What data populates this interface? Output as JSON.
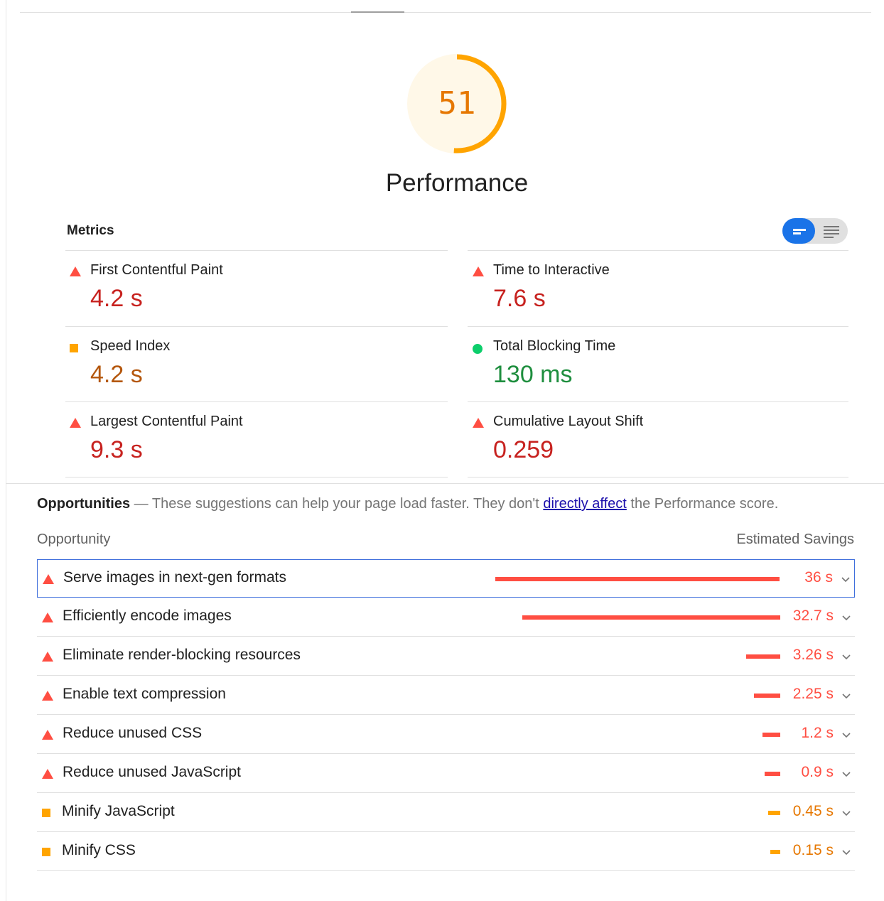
{
  "colors": {
    "fail": "#ff4e42",
    "fail_text": "#c7221f",
    "average": "#ffa400",
    "average_text": "#b4570d",
    "pass": "#0cce6b",
    "pass_text": "#1e8e3e",
    "accent": "#1a73e8"
  },
  "score": {
    "value": "51",
    "fraction": 0.51,
    "label": "Performance"
  },
  "metrics": {
    "title": "Metrics",
    "items": [
      {
        "label": "First Contentful Paint",
        "value": "4.2 s",
        "rating": "fail"
      },
      {
        "label": "Time to Interactive",
        "value": "7.6 s",
        "rating": "fail"
      },
      {
        "label": "Speed Index",
        "value": "4.2 s",
        "rating": "average"
      },
      {
        "label": "Total Blocking Time",
        "value": "130 ms",
        "rating": "pass"
      },
      {
        "label": "Largest Contentful Paint",
        "value": "9.3 s",
        "rating": "fail"
      },
      {
        "label": "Cumulative Layout Shift",
        "value": "0.259",
        "rating": "fail"
      }
    ]
  },
  "opportunities": {
    "title": "Opportunities",
    "dash": " — ",
    "description_before": "These suggestions can help your page load faster. They don't ",
    "link_text": "directly affect",
    "description_after": " the Performance score.",
    "column_opportunity": "Opportunity",
    "column_savings": "Estimated Savings",
    "items": [
      {
        "label": "Serve images in next-gen formats",
        "savings": "36 s",
        "seconds": 36,
        "rating": "fail",
        "selected": true
      },
      {
        "label": "Efficiently encode images",
        "savings": "32.7 s",
        "seconds": 32.7,
        "rating": "fail",
        "selected": false
      },
      {
        "label": "Eliminate render-blocking resources",
        "savings": "3.26 s",
        "seconds": 3.26,
        "rating": "fail",
        "selected": false
      },
      {
        "label": "Enable text compression",
        "savings": "2.25 s",
        "seconds": 2.25,
        "rating": "fail",
        "selected": false
      },
      {
        "label": "Reduce unused CSS",
        "savings": "1.2 s",
        "seconds": 1.2,
        "rating": "fail",
        "selected": false
      },
      {
        "label": "Reduce unused JavaScript",
        "savings": "0.9 s",
        "seconds": 0.9,
        "rating": "fail",
        "selected": false
      },
      {
        "label": "Minify JavaScript",
        "savings": "0.45 s",
        "seconds": 0.45,
        "rating": "average",
        "selected": false
      },
      {
        "label": "Minify CSS",
        "savings": "0.15 s",
        "seconds": 0.15,
        "rating": "average",
        "selected": false
      }
    ]
  }
}
